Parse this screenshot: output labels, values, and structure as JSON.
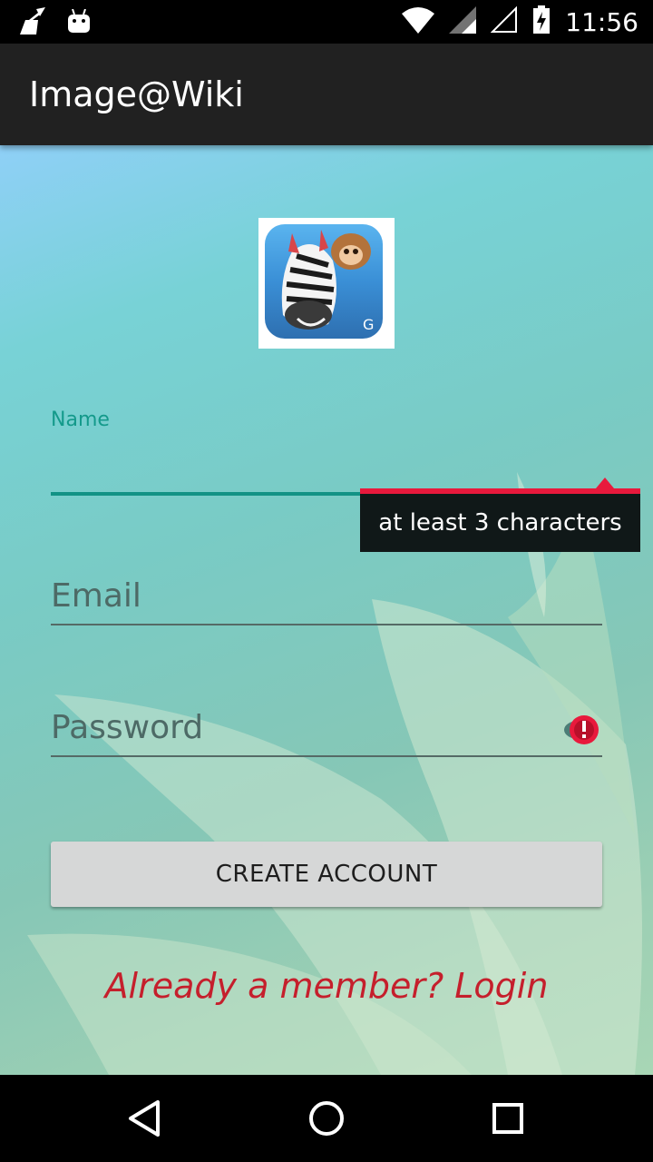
{
  "status_bar": {
    "time": "11:56",
    "icons": [
      "broom-icon",
      "android-icon",
      "wifi-icon",
      "signal-icon",
      "signal-empty-icon",
      "battery-charging-icon"
    ]
  },
  "app_bar": {
    "title": "Image@Wiki"
  },
  "form": {
    "name": {
      "label": "Name",
      "value": "",
      "error": "at least 3 characters"
    },
    "email": {
      "placeholder": "Email",
      "value": ""
    },
    "password": {
      "placeholder": "Password",
      "value": ""
    },
    "create_button": "CREATE ACCOUNT",
    "login_link": "Already a member? Login"
  },
  "nav": {
    "icons": [
      "back-icon",
      "home-icon",
      "recents-icon"
    ]
  },
  "colors": {
    "accent": "#149a8b",
    "error": "#e8193c",
    "link": "#c51f2c",
    "app_bar": "#212121"
  }
}
